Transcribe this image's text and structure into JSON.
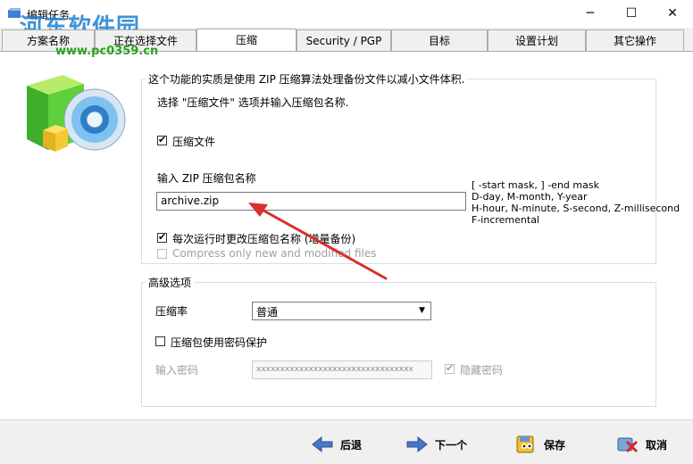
{
  "window": {
    "title": "编辑任务",
    "minimize_glyph": "─",
    "maximize_glyph": "☐",
    "close_glyph": "✕"
  },
  "watermark": {
    "text": "河东软件园",
    "url": "www.pc0359.cn"
  },
  "tabs": [
    {
      "label": "方案名称",
      "active": false
    },
    {
      "label": "正在选择文件",
      "active": false
    },
    {
      "label": "压缩",
      "active": true
    },
    {
      "label": "Security / PGP",
      "active": false
    },
    {
      "label": "目标",
      "active": false
    },
    {
      "label": "设置计划",
      "active": false
    },
    {
      "label": "其它操作",
      "active": false
    }
  ],
  "compression_group": {
    "legend": "这个功能的实质是使用 ZIP 压缩算法处理备份文件以减小文件体积.",
    "instruction": "选择 \"压缩文件\" 选项并输入压缩包名称.",
    "compress_checkbox": {
      "label": "压缩文件",
      "checked": true
    },
    "zip_name_label": "输入 ZIP 压缩包名称",
    "zip_name_value": "archive.zip",
    "hint_lines": [
      "[ -start mask, ] -end mask",
      "D-day, M-month, Y-year",
      "H-hour, N-minute, S-second,  Z-millisecond",
      "F-incremental"
    ],
    "rename_checkbox": {
      "label": "每次运行时更改压缩包名称 (增量备份)",
      "checked": true
    },
    "new_modified_checkbox": {
      "label": "Compress only new and modified files",
      "checked": false,
      "disabled": true
    }
  },
  "advanced_group": {
    "legend": "高级选项",
    "ratio_label": "压缩率",
    "ratio_value": "普通",
    "password_checkbox": {
      "label": "压缩包使用密码保护",
      "checked": false
    },
    "password_label": "输入密码",
    "password_value": "xxxxxxxxxxxxxxxxxxxxxxxxxxxxxxxxx",
    "hide_password_checkbox": {
      "label": "隐藏密码",
      "checked": true,
      "disabled": true
    }
  },
  "buttons": {
    "back": "后退",
    "next": "下一个",
    "save": "保存",
    "cancel": "取消"
  },
  "icons": {
    "back": "left-arrow-icon",
    "next": "right-arrow-icon",
    "save": "save-icon",
    "cancel": "cancel-icon",
    "logo": "compression-box-disc-icon"
  },
  "colors": {
    "arrow_blue": "#3a6fc4",
    "annotation_red": "#d9302a",
    "watermark_blue": "#1e7fd0",
    "watermark_green": "#2aa31f"
  }
}
